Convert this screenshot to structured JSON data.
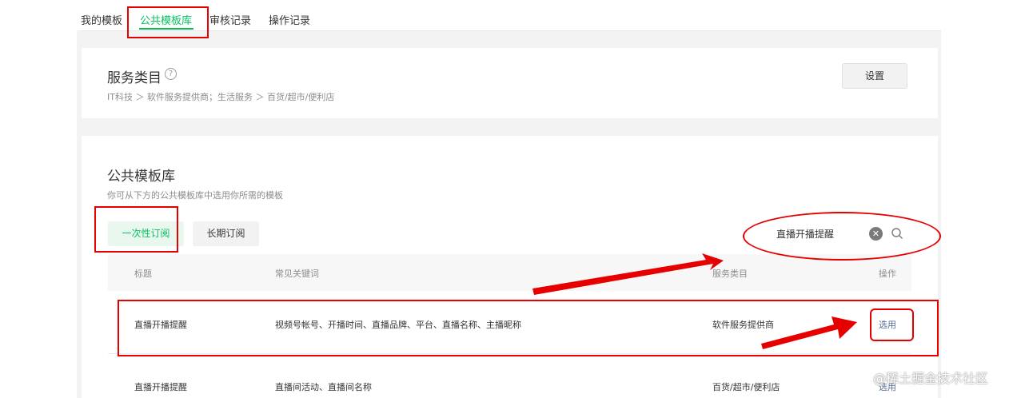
{
  "tabs": [
    "我的模板",
    "公共模板库",
    "审核记录",
    "操作记录"
  ],
  "service": {
    "title": "服务类目",
    "help_icon": "?",
    "breadcrumb": "IT科技 ＞ 软件服务提供商；生活服务 ＞ 百货/超市/便利店",
    "setting_button": "设置"
  },
  "library": {
    "title": "公共模板库",
    "description": "你可从下方的公共模板库中选用你所需的模板",
    "segments": [
      "一次性订阅",
      "长期订阅"
    ],
    "search": {
      "value": "直播开播提醒",
      "placeholder": ""
    }
  },
  "table": {
    "headers": [
      "标题",
      "常见关键词",
      "服务类目",
      "操作"
    ],
    "rows": [
      {
        "title": "直播开播提醒",
        "keywords": "视频号帐号、开播时间、直播品牌、平台、直播名称、主播昵称",
        "category": "软件服务提供商",
        "action": "选用"
      },
      {
        "title": "直播开播提醒",
        "keywords": "直播间活动、直播间名称",
        "category": "百货/超市/便利店",
        "action": "选用"
      }
    ]
  },
  "watermark": "@稀土掘金技术社区",
  "colors": {
    "accent": "#07c160",
    "link": "#576b95",
    "annotation": "#e60000"
  }
}
